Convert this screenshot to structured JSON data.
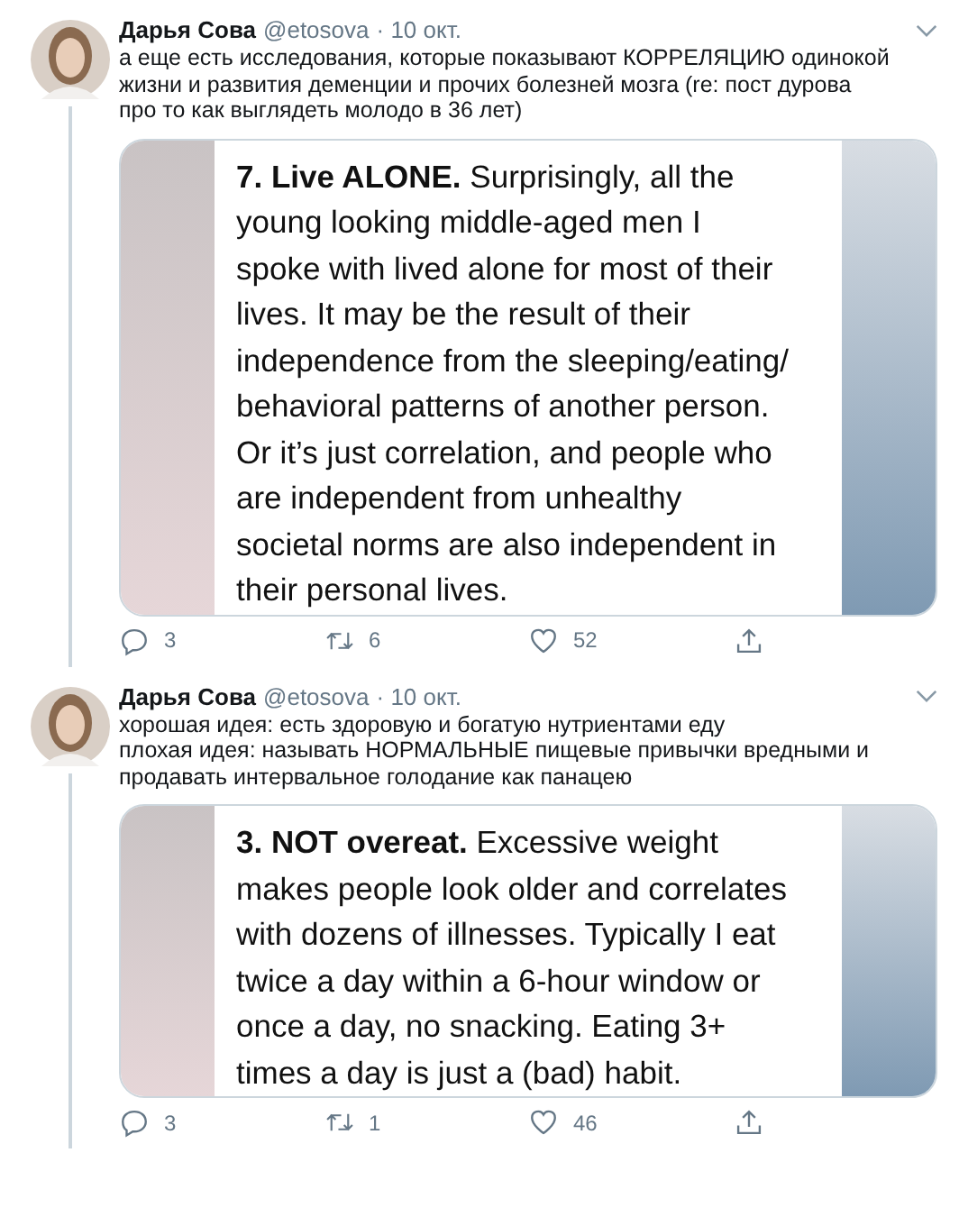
{
  "tweets": [
    {
      "name": "Дарья Сова",
      "handle": "@etosova",
      "date": "· 10 окт.",
      "thread": true,
      "text": [
        "а еще есть исследования, которые показывают КОРРЕЛЯЦИЮ одинокой",
        "жизни и развития деменции и прочих болезней мозга (re: пост дурова",
        "про то как выглядеть молодо в 36 лет)"
      ],
      "image_lines": [
        "**7. Live ALONE.** Surprisingly, all the",
        "young looking middle-aged men I",
        "spoke with lived alone for most of their",
        "lives. It may be the result of their",
        "independence from the sleeping/eating/",
        "behavioral patterns of another person.",
        "Or it’s just correlation, and people who",
        "are independent from unhealthy",
        "societal norms are also independent in",
        "their personal lives."
      ],
      "replies": "3",
      "retweets": "6",
      "likes": "52"
    },
    {
      "name": "Дарья Сова",
      "handle": "@etosova",
      "date": "· 10 окт.",
      "thread": true,
      "text": [
        "хорошая идея: есть здоровую и богатую нутриентами еду",
        "плохая идея: называть НОРМАЛЬНЫЕ пищевые привычки вредными и",
        "продавать интервальное голодание как панацею"
      ],
      "image_lines": [
        "**3. NOT overeat.** Excessive weight",
        "makes people look older and correlates",
        "with dozens of illnesses. Typically I eat",
        "twice a day within a 6-hour window or",
        "once a day, no snacking. Eating 3+",
        "times a day is just a (bad) habit."
      ],
      "replies": "3",
      "retweets": "1",
      "likes": "46"
    }
  ]
}
